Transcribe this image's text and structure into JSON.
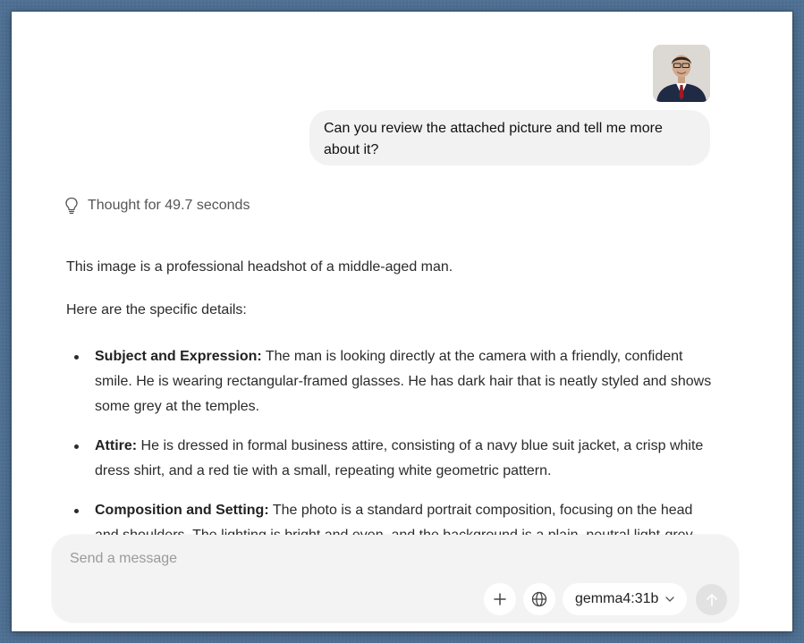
{
  "conversation": {
    "user_message": "Can you review the attached picture and tell me more about it?",
    "thought": "Thought for 49.7 seconds",
    "answer": {
      "intro": "This image is a professional headshot of a middle-aged man.",
      "lead": "Here are the specific details:",
      "items": [
        {
          "title": "Subject and Expression:",
          "text": " The man is looking directly at the camera with a friendly, confident smile. He is wearing rectangular-framed glasses. He has dark hair that is neatly styled and shows some grey at the temples."
        },
        {
          "title": "Attire:",
          "text": " He is dressed in formal business attire, consisting of a navy blue suit jacket, a crisp white dress shirt, and a red tie with a small, repeating white geometric pattern."
        },
        {
          "title": "Composition and Setting:",
          "text": " The photo is a standard portrait composition, focusing on the head and shoulders. The lighting is bright and even, and the background is a plain, neutral light-grey"
        }
      ]
    }
  },
  "composer": {
    "placeholder": "Send a message",
    "model": "gemma4:31b",
    "icons": [
      "plus-icon",
      "globe-icon",
      "chevron-down-icon",
      "arrow-up-icon"
    ]
  },
  "colors": {
    "desktop": "#4e6f92",
    "bubble": "#f2f2f2",
    "composer": "#f3f3f3"
  }
}
